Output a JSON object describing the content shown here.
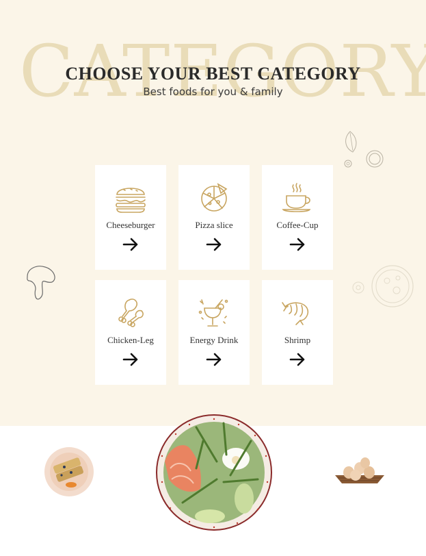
{
  "section": {
    "watermark": "CATEGORY",
    "title": "CHOOSE YOUR BEST CATEGORY",
    "subtitle": "Best foods for you & family"
  },
  "categories": [
    {
      "label": "Cheeseburger",
      "icon": "burger-icon"
    },
    {
      "label": "Pizza slice",
      "icon": "pizza-icon"
    },
    {
      "label": "Coffee-Cup",
      "icon": "coffee-cup-icon"
    },
    {
      "label": "Chicken-Leg",
      "icon": "chicken-leg-icon"
    },
    {
      "label": "Energy Drink",
      "icon": "cocktail-icon"
    },
    {
      "label": "Shrimp",
      "icon": "shrimp-icon"
    }
  ],
  "colors": {
    "background": "#fbf5e8",
    "accent": "#c8a560",
    "watermark": "#e9dcb8"
  }
}
